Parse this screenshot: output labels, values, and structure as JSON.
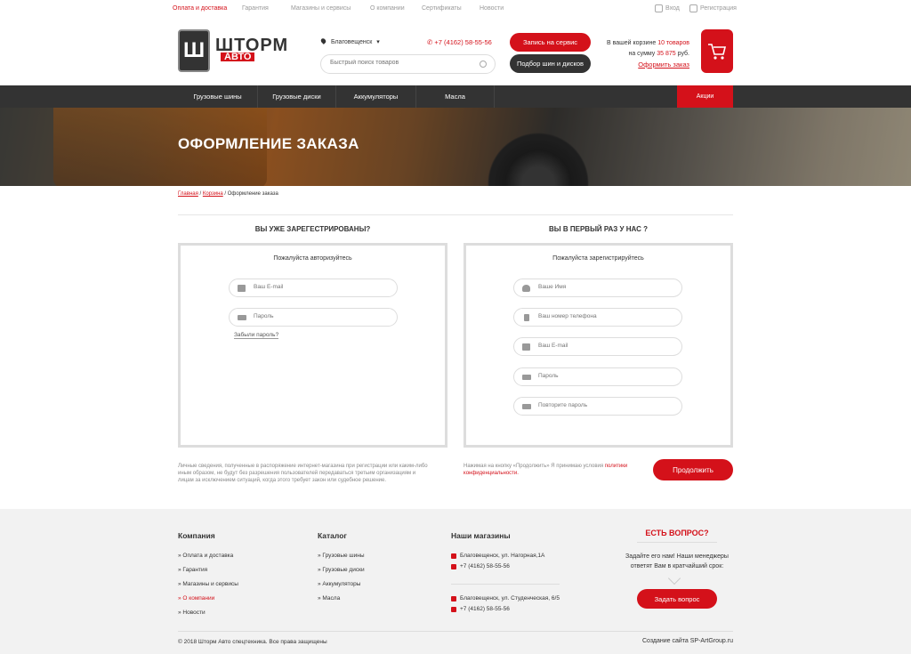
{
  "topbar": {
    "links": [
      "Оплата и доставка",
      "Гарантия",
      "Магазины и сервисы",
      "О компании",
      "Сертификаты",
      "Новости"
    ],
    "login": "Вход",
    "register": "Регистрация"
  },
  "header": {
    "logo_main": "ШТОРМ",
    "logo_sub": "АВТО",
    "logo_mark": "Ш",
    "city": "Благовещенск",
    "phone": "+7 (4162) 58-55-56",
    "search_placeholder": "Быстрый поиск товаров",
    "service_button": "Запись на сервис",
    "tires_button": "Подбор шин и дисков",
    "cart_line1_prefix": "В вашей корзине",
    "cart_count": "10 товаров",
    "cart_line2_prefix": "на сумму",
    "cart_sum": "35 875",
    "cart_currency": "руб.",
    "checkout_link": "Оформить заказ"
  },
  "nav": {
    "items": [
      "Грузовые шины",
      "Грузовые диски",
      "Аккумуляторы",
      "Масла"
    ],
    "sale": "Акции"
  },
  "hero": {
    "title": "ОФОРМЛЕНИЕ ЗАКАЗА"
  },
  "breadcrumb": {
    "home": "Главная",
    "cart": "Корзина",
    "current": "Оформление заказа",
    "sep": " / "
  },
  "login_panel": {
    "title": "ВЫ УЖЕ ЗАРЕГЕСТРИРОВАНЫ?",
    "subtitle": "Пожалуйста авторизуйтесь",
    "email_placeholder": "Ваш E-mail",
    "password_placeholder": "Пароль",
    "forgot": "Забыли пароль?"
  },
  "register_panel": {
    "title": "ВЫ В ПЕРВЫЙ РАЗ У НАС ?",
    "subtitle": "Пожалуйста зарегистрируйтесь",
    "name_placeholder": "Ваше Имя",
    "phone_placeholder": "Ваш номер телефона",
    "email_placeholder": "Ваш E-mail",
    "password_placeholder": "Пароль",
    "repeat_placeholder": "Повторите пароль"
  },
  "notes": {
    "privacy": "Личные сведения, полученные в распоряжение интернет-магазина при регистрации или каким-либо иным образом, не будут без разрешения пользователей передаваться третьим организациям и лицам за исключением ситуаций, когда этого требует закон или судебное решение.",
    "consent_prefix": "Нажимая на кнопку «Продолжить» Я принимаю условия",
    "consent_link": "политики конфиденциальности."
  },
  "continue_button": "Продолжить",
  "footer": {
    "company_title": "Компания",
    "company_items": [
      "Оплата и доставка",
      "Гарантия",
      "Магазины и сервисы",
      "О компании",
      "Новости"
    ],
    "catalog_title": "Каталог",
    "catalog_items": [
      "Грузовые шины",
      "Грузовые диски",
      "Аккумуляторы",
      "Масла"
    ],
    "shops_title": "Наши магазины",
    "shop1_address": "Благовещенск, ул. Нагорная,1А",
    "shop1_phone": "+7 (4162) 58-55-56",
    "shop2_address": "Благовещенск, ул. Студенческая, 6/5",
    "shop2_phone": "+7 (4162) 58-55-56",
    "question_title": "ЕСТЬ ВОПРОС?",
    "question_text": "Задайте его нам! Наши менеджеры ответят Вам в кратчайший срок:",
    "ask_button": "Задать вопрос",
    "copyright": "© 2018 Шторм Авто спецтехника. Все права защищены",
    "developer": "Создание сайта SP-ArtGroup.ru"
  },
  "colors": {
    "accent": "#d4111a",
    "dark": "#333333",
    "footer_bg": "#f2f2f2"
  }
}
